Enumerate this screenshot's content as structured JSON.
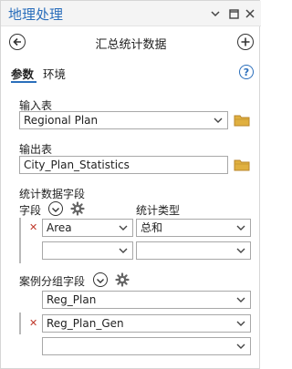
{
  "window": {
    "title": "地理处理"
  },
  "nav": {
    "title": "汇总统计数据"
  },
  "tabs": [
    {
      "label": "参数"
    },
    {
      "label": "环境"
    }
  ],
  "help": {
    "label": "?"
  },
  "input_table": {
    "label": "输入表",
    "value": "Regional Plan"
  },
  "output_table": {
    "label": "输出表",
    "value": "City_Plan_Statistics"
  },
  "stat_fields": {
    "label": "统计数据字段",
    "field_header": "字段",
    "type_header": "统计类型",
    "rows": [
      {
        "field": "Area",
        "type": "总和"
      },
      {
        "field": "",
        "type": ""
      }
    ]
  },
  "case_fields": {
    "label": "案例分组字段",
    "rows": [
      {
        "value": "Reg_Plan"
      },
      {
        "value": "Reg_Plan_Gen"
      },
      {
        "value": ""
      }
    ]
  },
  "colors": {
    "accent": "#2a6ebb",
    "folder": "#e0b040",
    "remove": "#c0392b"
  }
}
